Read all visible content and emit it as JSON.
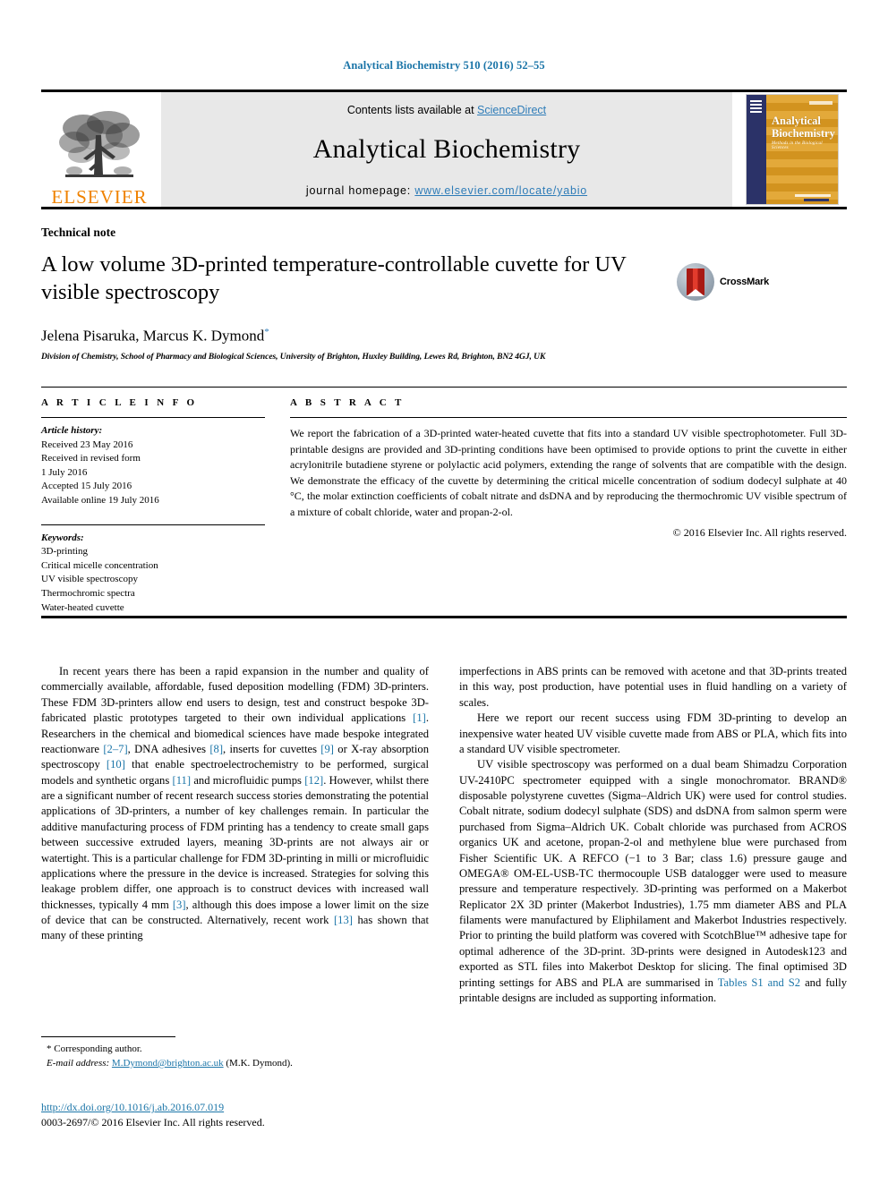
{
  "running_head": "Analytical Biochemistry 510 (2016) 52–55",
  "masthead": {
    "publisher_name": "ELSEVIER",
    "contents_prefix": "Contents lists available at ",
    "contents_link": "ScienceDirect",
    "journal_title": "Analytical Biochemistry",
    "homepage_prefix": "journal homepage: ",
    "homepage_url": "www.elsevier.com/locate/yabio",
    "cover": {
      "title_line1": "Analytical",
      "title_line2": "Biochemistry",
      "subtitle": "Methods in the Biological Sciences"
    }
  },
  "article": {
    "kind": "Technical note",
    "title": "A low volume 3D-printed temperature-controllable cuvette for UV visible spectroscopy",
    "crossmark_label": "CrossMark",
    "authors": "Jelena Pisaruka, Marcus K. Dymond",
    "author_marker": "*",
    "affiliation": "Division of Chemistry, School of Pharmacy and Biological Sciences, University of Brighton, Huxley Building, Lewes Rd, Brighton, BN2 4GJ, UK"
  },
  "article_info": {
    "heading": "A R T I C L E   I N F O",
    "history_label": "Article history:",
    "history": [
      "Received 23 May 2016",
      "Received in revised form",
      "1 July 2016",
      "Accepted 15 July 2016",
      "Available online 19 July 2016"
    ],
    "keywords_label": "Keywords:",
    "keywords": [
      "3D-printing",
      "Critical micelle concentration",
      "UV visible spectroscopy",
      "Thermochromic spectra",
      "Water-heated cuvette"
    ]
  },
  "abstract": {
    "heading": "A B S T R A C T",
    "text": "We report the fabrication of a 3D-printed water-heated cuvette that fits into a standard UV visible spectrophotometer. Full 3D-printable designs are provided and 3D-printing conditions have been optimised to provide options to print the cuvette in either acrylonitrile butadiene styrene or polylactic acid polymers, extending the range of solvents that are compatible with the design. We demonstrate the efficacy of the cuvette by determining the critical micelle concentration of sodium dodecyl sulphate at 40 °C, the molar extinction coefficients of cobalt nitrate and dsDNA and by reproducing the thermochromic UV visible spectrum of a mixture of cobalt chloride, water and propan-2-ol.",
    "copyright": "© 2016 Elsevier Inc. All rights reserved."
  },
  "body": {
    "left": {
      "p1_a": "In recent years there has been a rapid expansion in the number and quality of commercially available, affordable, fused deposition modelling (FDM) 3D-printers. These FDM 3D-printers allow end users to design, test and construct bespoke 3D-fabricated plastic prototypes targeted to their own individual applications ",
      "r1": "[1]",
      "p1_b": ". Researchers in the chemical and biomedical sciences have made bespoke integrated reactionware ",
      "r2": "[2–7]",
      "p1_c": ", DNA adhesives ",
      "r3": "[8]",
      "p1_d": ", inserts for cuvettes ",
      "r4": "[9]",
      "p1_e": " or X-ray absorption spectroscopy ",
      "r5": "[10]",
      "p1_f": " that enable spectroelectrochemistry to be performed, surgical models and synthetic organs ",
      "r6": "[11]",
      "p1_g": " and microfluidic pumps ",
      "r7": "[12]",
      "p1_h": ". However, whilst there are a significant number of recent research success stories demonstrating the potential applications of 3D-printers, a number of key challenges remain. In particular the additive manufacturing process of FDM printing has a tendency to create small gaps between successive extruded layers, meaning 3D-prints are not always air or watertight. This is a particular challenge for FDM 3D-printing in milli or microfluidic applications where the pressure in the device is increased. Strategies for solving this leakage problem differ, one approach is to construct devices with increased wall thicknesses, typically 4 mm ",
      "r8": "[3]",
      "p1_i": ", although this does impose a lower limit on the size of device that can be constructed. Alternatively, recent work ",
      "r9": "[13]",
      "p1_j": " has shown that many of these printing"
    },
    "right": {
      "p1": "imperfections in ABS prints can be removed with acetone and that 3D-prints treated in this way, post production, have potential uses in fluid handling on a variety of scales.",
      "p2": "Here we report our recent success using FDM 3D-printing to develop an inexpensive water heated UV visible cuvette made from ABS or PLA, which fits into a standard UV visible spectrometer.",
      "p3_a": "UV visible spectroscopy was performed on a dual beam Shimadzu Corporation UV-2410PC spectrometer equipped with a single monochromator. BRAND® disposable polystyrene cuvettes (Sigma–Aldrich UK) were used for control studies. Cobalt nitrate, sodium dodecyl sulphate (SDS) and dsDNA from salmon sperm were purchased from Sigma–Aldrich UK. Cobalt chloride was purchased from ACROS organics UK and acetone, propan-2-ol and methylene blue were purchased from Fisher Scientific UK. A REFCO (−1 to 3 Bar; class 1.6) pressure gauge and OMEGA® OM-EL-USB-TC thermocouple USB datalogger were used to measure pressure and temperature respectively. 3D-printing was performed on a Makerbot Replicator 2X 3D printer (Makerbot Industries), 1.75 mm diameter ABS and PLA filaments were manufactured by Eliphilament and Makerbot Industries respectively. Prior to printing the build platform was covered with ScotchBlue™ adhesive tape for optimal adherence of the 3D-print. 3D-prints were designed in Autodesk123 and exported as STL files into Makerbot Desktop for slicing. The final optimised 3D printing settings for ABS and PLA are summarised in ",
      "p3_link": "Tables S1 and S2",
      "p3_b": " and fully printable designs are included as supporting information."
    }
  },
  "footnote": {
    "marker": "*",
    "corresponding": "Corresponding author.",
    "email_label": "E-mail address:",
    "email": "M.Dymond@brighton.ac.uk",
    "email_suffix": "(M.K. Dymond)."
  },
  "footer": {
    "doi": "http://dx.doi.org/10.1016/j.ab.2016.07.019",
    "issn_line": "0003-2697/© 2016 Elsevier Inc. All rights reserved."
  },
  "colors": {
    "link_blue": "#1b75a8",
    "sciencedirect_blue": "#2e7cb8",
    "elsevier_orange": "#ef8200",
    "cover_navy": "#2b3268",
    "cover_gold": "#d99a2b"
  }
}
